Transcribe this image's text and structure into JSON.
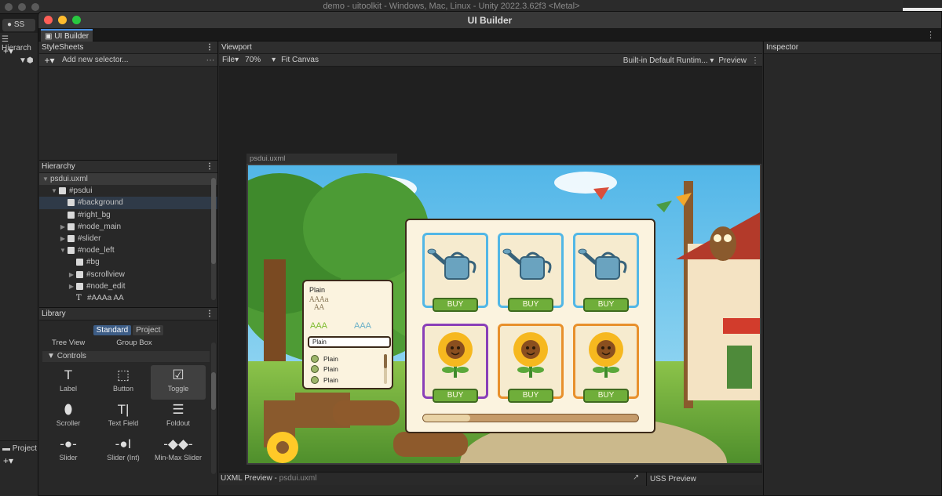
{
  "os_window": {
    "title": "demo - uitoolkit - Windows, Mac, Linux - Unity 2022.3.62f3 <Metal>",
    "account_button": "SS",
    "hierarchy_tab": "Hierarch",
    "project_tab": "Project"
  },
  "window": {
    "title": "UI Builder",
    "tab_label": "UI Builder"
  },
  "stylesheets": {
    "header": "StyleSheets",
    "add_selector_placeholder": "Add new selector..."
  },
  "hierarchy": {
    "header": "Hierarchy",
    "items": [
      {
        "label": "psdui.uxml",
        "depth": 0,
        "caret": "▼",
        "icon": "none",
        "state": "selected"
      },
      {
        "label": "#psdui",
        "depth": 1,
        "caret": "▼",
        "icon": "box",
        "state": ""
      },
      {
        "label": "#background",
        "depth": 2,
        "caret": "",
        "icon": "box",
        "state": "highlight"
      },
      {
        "label": "#right_bg",
        "depth": 2,
        "caret": "",
        "icon": "box",
        "state": ""
      },
      {
        "label": "#node_main",
        "depth": 2,
        "caret": "▶",
        "icon": "box",
        "state": ""
      },
      {
        "label": "#slider",
        "depth": 2,
        "caret": "▶",
        "icon": "box",
        "state": ""
      },
      {
        "label": "#node_left",
        "depth": 2,
        "caret": "▼",
        "icon": "box",
        "state": ""
      },
      {
        "label": "#bg",
        "depth": 3,
        "caret": "",
        "icon": "box",
        "state": ""
      },
      {
        "label": "#scrollview",
        "depth": 3,
        "caret": "▶",
        "icon": "box",
        "state": ""
      },
      {
        "label": "#node_edit",
        "depth": 3,
        "caret": "▶",
        "icon": "box",
        "state": ""
      },
      {
        "label": "#AAAa AA",
        "depth": 3,
        "caret": "",
        "icon": "text",
        "state": ""
      }
    ]
  },
  "library": {
    "header": "Library",
    "toggle_standard": "Standard",
    "toggle_project": "Project",
    "top_items": [
      "Tree View",
      "Group Box"
    ],
    "controls_header": "Controls",
    "controls": [
      {
        "label": "Label",
        "icon": "T"
      },
      {
        "label": "Button",
        "icon": "⬚"
      },
      {
        "label": "Toggle",
        "icon": "☑"
      },
      {
        "label": "Scroller",
        "icon": "⬮"
      },
      {
        "label": "Text Field",
        "icon": "T|"
      },
      {
        "label": "Foldout",
        "icon": "☰"
      },
      {
        "label": "Slider",
        "icon": "-●-"
      },
      {
        "label": "Slider (Int)",
        "icon": "-●I"
      },
      {
        "label": "Min-Max Slider",
        "icon": "-◆◆-"
      }
    ]
  },
  "viewport": {
    "header": "Viewport",
    "file_menu": "File",
    "zoom": "70%",
    "fit_canvas": "Fit Canvas",
    "theme_dropdown": "Built-in Default Runtim...",
    "preview": "Preview",
    "canvas_tab": "psdui.uxml",
    "uxml_preview": "UXML Preview",
    "uxml_file": "psdui.uxml",
    "uss_preview": "USS Preview"
  },
  "inspector": {
    "header": "Inspector"
  },
  "game_ui": {
    "left_panel": {
      "title": "Plain",
      "styled_text_line1": "AAAa",
      "styled_text_line2": "AA",
      "label_left": "AAA",
      "label_right": "AAA",
      "input_value": "Plain",
      "toggles": [
        "Plain",
        "Plain",
        "Plain"
      ]
    },
    "shop": {
      "buy_label": "BUY",
      "items": [
        {
          "kind": "watering-can",
          "frame": "#52b7e6"
        },
        {
          "kind": "watering-can",
          "frame": "#52b7e6"
        },
        {
          "kind": "watering-can",
          "frame": "#52b7e6"
        },
        {
          "kind": "sunflower",
          "frame": "#8a3fb8"
        },
        {
          "kind": "sunflower",
          "frame": "#e8902c"
        },
        {
          "kind": "sunflower",
          "frame": "#e8902c"
        }
      ],
      "progress": 0.22
    }
  }
}
